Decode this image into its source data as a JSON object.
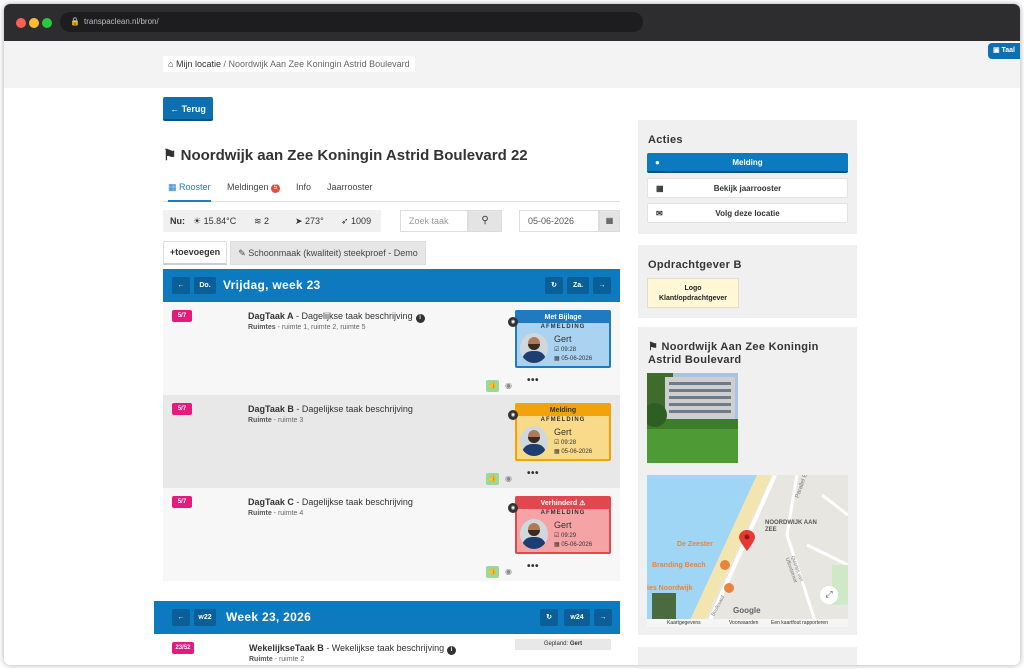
{
  "browser": {
    "url": "transpaclean.nl/bron/"
  },
  "topbar": {
    "home": "Mijn locatie",
    "separator": "/",
    "current": "Noordwijk Aan Zee Koningin Astrid Boulevard",
    "lang_button": "Taal"
  },
  "back_button": "← Terug",
  "page": {
    "title": "Noordwijk aan Zee Koningin Astrid Boulevard 22"
  },
  "tabs": [
    {
      "label": "Rooster"
    },
    {
      "label": "Meldingen",
      "badge": "5"
    },
    {
      "label": "Info"
    },
    {
      "label": "Jaarrooster"
    }
  ],
  "weather": {
    "now_label": "Nu:",
    "temp": "15.84°C",
    "wind": "2",
    "direction": "273°",
    "pressure": "1009"
  },
  "search": {
    "placeholder": "Zoek taak"
  },
  "date_input": "05-06-2026",
  "actions_row": {
    "add": "+toevoegen",
    "sample": "Schoonmaak (kwaliteit) steekproef - Demo"
  },
  "daybar": {
    "prev": "←",
    "prev_day": "Do.",
    "title": "Vrijdag, week 23",
    "refresh": "↻",
    "next_day": "Za.",
    "next": "→"
  },
  "tasks": [
    {
      "count": "5/7",
      "name": "DagTaak A",
      "desc": " - Dagelijkse taak beschrijving",
      "sub_label": "Ruimtes",
      "sub_value": " - ruimte 1, ruimte 2, ruimte 5",
      "status": "Met Bijlage",
      "report": "AFMELDING",
      "worker": "Gert",
      "time": "09:28",
      "date": "05-06-2026",
      "colors": {
        "head": "#1f7ac1",
        "headtext": "#ffffff",
        "body": "#a9d3f1",
        "border": "#1f7ac1",
        "row": "#f7f7f7"
      }
    },
    {
      "count": "5/7",
      "name": "DagTaak B",
      "desc": " - Dagelijkse taak beschrijving",
      "sub_label": "Ruimte",
      "sub_value": " - ruimte 3",
      "status": "Melding",
      "report": "AFMELDING",
      "worker": "Gert",
      "time": "09:28",
      "date": "05-06-2026",
      "colors": {
        "head": "#f0a30a",
        "headtext": "#333333",
        "body": "#f9d98a",
        "border": "#f0a30a",
        "row": "#e8e8e8"
      }
    },
    {
      "count": "5/7",
      "name": "DagTaak C",
      "desc": " - Dagelijkse taak beschrijving",
      "sub_label": "Ruimte",
      "sub_value": " - ruimte 4",
      "status": "Verhinderd ⚠",
      "report": "AFMELDING",
      "worker": "Gert",
      "time": "09:29",
      "date": "05-06-2026",
      "colors": {
        "head": "#e0474f",
        "headtext": "#ffffff",
        "body": "#f6a3a5",
        "border": "#e0474f",
        "row": "#f7f7f7"
      }
    }
  ],
  "weekbar": {
    "prev": "←",
    "prev_week": "w22",
    "title": "Week 23, 2026",
    "refresh": "↻",
    "next_week": "w24",
    "next": "→"
  },
  "week_task": {
    "count": "23/52",
    "name": "WekelijkseTaak B",
    "desc": " - Wekelijkse taak beschrijving",
    "sub_label": "Ruimte",
    "sub_value": " - ruimte 2",
    "planned": "Gepland:",
    "planned_name": "Gert"
  },
  "sidebar": {
    "actions_title": "Acties",
    "actions": [
      {
        "label": "Melding"
      },
      {
        "label": "Bekijk jaarrooster"
      },
      {
        "label": "Volg deze locatie"
      }
    ],
    "client_title": "Opdrachtgever B",
    "logo_line1": "Logo",
    "logo_line2": "Klant/opdrachtgever",
    "location_title": "Noordwijk Aan Zee Koningin Astrid Boulevard",
    "map": {
      "area": "NOORDWIJK AAN ZEE",
      "poi1": "De Zeester",
      "poi2": "Branding Beach",
      "poi3": "ies Noordwijk",
      "street1": "Parallel B",
      "street2": "Quarles van Uffordstraat",
      "street3": "Boulevard",
      "attr1": "Kaartgegevens",
      "attr2": "Voorwaarden",
      "attr3": "Een kaartfout rapporteren",
      "brand": "Google"
    }
  },
  "colors": {
    "accent": "#0d7ac0",
    "pill": "#e6197d"
  }
}
